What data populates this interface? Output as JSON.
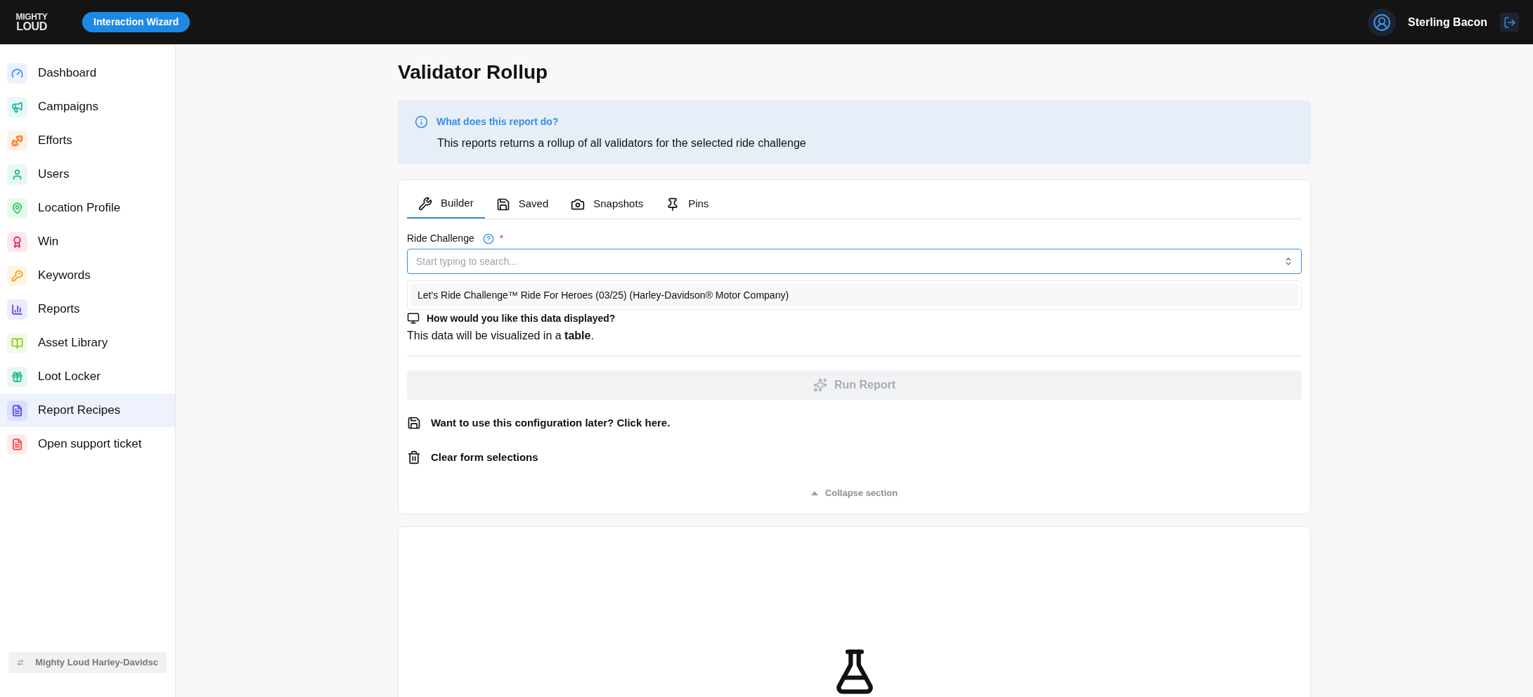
{
  "header": {
    "logo": {
      "top": "MIGHTY",
      "bottom": "LOUD"
    },
    "wizard_button": "Interaction Wizard",
    "user_name": "Sterling Bacon"
  },
  "sidebar": {
    "items": [
      {
        "label": "Dashboard",
        "color": "#3b82f6",
        "selected": false
      },
      {
        "label": "Campaigns",
        "color": "#14b8a6",
        "selected": false
      },
      {
        "label": "Efforts",
        "color": "#f97316",
        "selected": false
      },
      {
        "label": "Users",
        "color": "#10b981",
        "selected": false
      },
      {
        "label": "Location Profile",
        "color": "#22c55e",
        "selected": false
      },
      {
        "label": "Win",
        "color": "#e11d48",
        "selected": false
      },
      {
        "label": "Keywords",
        "color": "#f59e0b",
        "selected": false
      },
      {
        "label": "Reports",
        "color": "#4f46e5",
        "selected": false
      },
      {
        "label": "Asset Library",
        "color": "#84cc16",
        "selected": false
      },
      {
        "label": "Loot Locker",
        "color": "#10b981",
        "selected": false
      },
      {
        "label": "Report Recipes",
        "color": "#4f46e5",
        "selected": true
      },
      {
        "label": "Open support ticket",
        "color": "#ef4444",
        "selected": false
      }
    ],
    "switcher": "Mighty Loud Harley-Davidsc"
  },
  "page": {
    "title": "Validator Rollup",
    "info": {
      "heading": "What does this report do?",
      "text": "This reports returns a rollup of all validators for the selected ride challenge"
    },
    "tabs": [
      {
        "label": "Builder",
        "selected": true
      },
      {
        "label": "Saved",
        "selected": false
      },
      {
        "label": "Snapshots",
        "selected": false
      },
      {
        "label": "Pins",
        "selected": false
      }
    ],
    "field": {
      "label": "Ride Challenge",
      "required_mark": "*",
      "placeholder": "Start typing to search...",
      "options": [
        "Let's Ride Challenge™ Ride For Heroes (03/25) (Harley-Davidson® Motor Company)"
      ]
    },
    "display_question": "How would you like this data displayed?",
    "display_text": "This data will be visualized in a **table**.",
    "run_button": {
      "label": "Run Report",
      "disabled": true
    },
    "save_link": "Want to use this configuration later? Click here.",
    "clear_link": "Clear form selections",
    "collapse": "Collapse section"
  }
}
